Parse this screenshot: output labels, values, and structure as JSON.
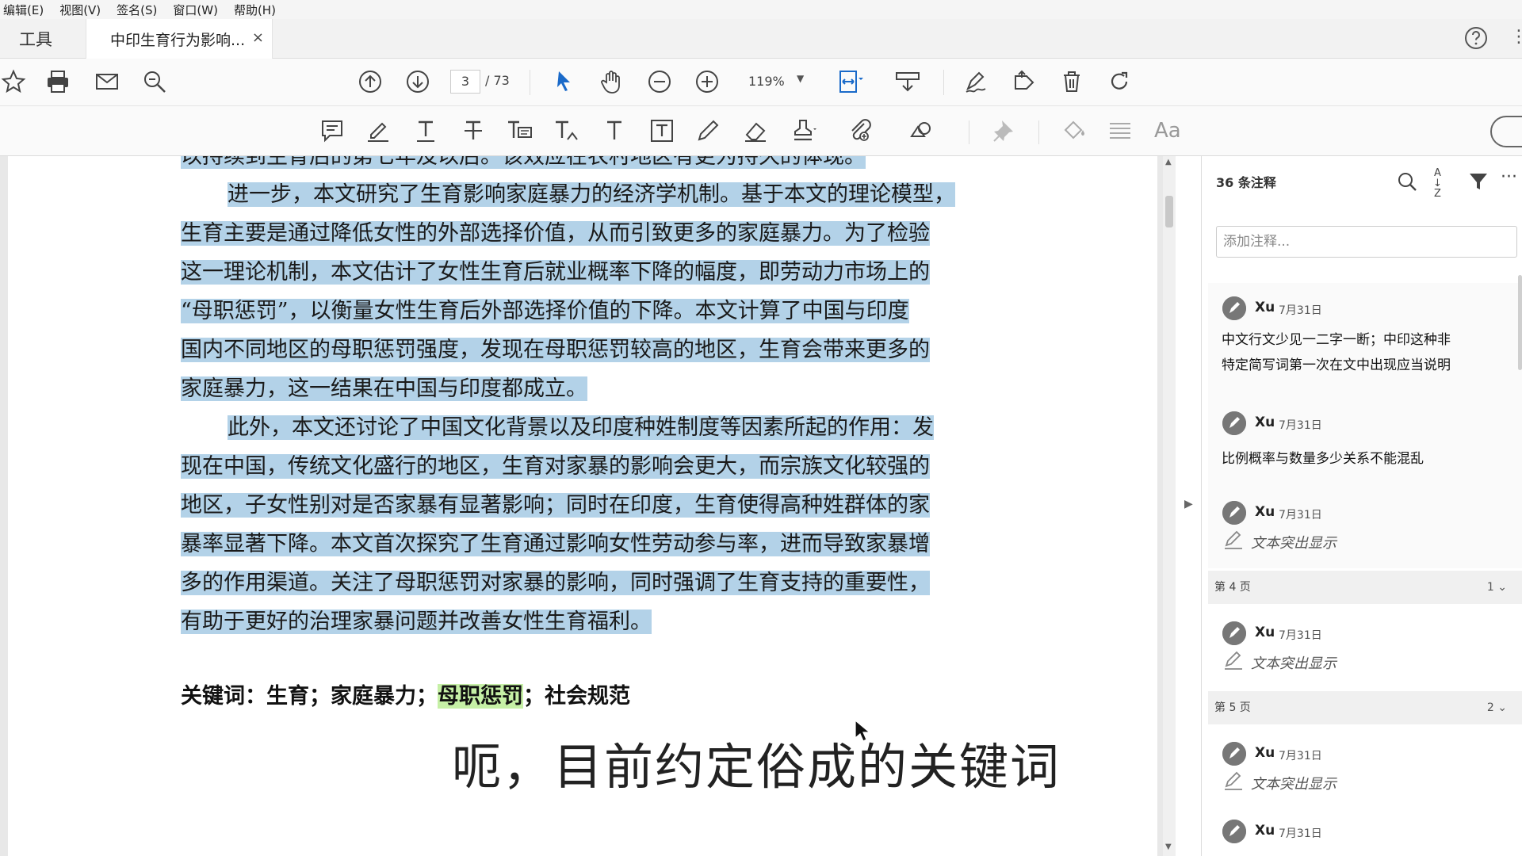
{
  "menu": {
    "items": [
      "编辑(E)",
      "视图(V)",
      "签名(S)",
      "窗口(W)",
      "帮助(H)"
    ]
  },
  "tabs": {
    "tools": "工具",
    "document": "中印生育行为影响...",
    "close": "×"
  },
  "toolbar": {
    "page_current": "3",
    "page_total": "/ 73",
    "zoom": "119%"
  },
  "document": {
    "lines": [
      {
        "text": "以持续到生育后的第七年及以后。该效应在农村地区有更为持久的体现。",
        "indent": false,
        "partial_top": true
      },
      {
        "text": "进一步，本文研究了生育影响家庭暴力的经济学机制。基于本文的理论模型，",
        "indent": true
      },
      {
        "text": "生育主要是通过降低女性的外部选择价值，从而引致更多的家庭暴力。为了检验",
        "indent": false
      },
      {
        "text": "这一理论机制，本文估计了女性生育后就业概率下降的幅度，即劳动力市场上的",
        "indent": false
      },
      {
        "text": "“母职惩罚”，以衡量女性生育后外部选择价值的下降。本文计算了中国与印度",
        "indent": false
      },
      {
        "text": "国内不同地区的母职惩罚强度，发现在母职惩罚较高的地区，生育会带来更多的",
        "indent": false
      },
      {
        "text": "家庭暴力，这一结果在中国与印度都成立。",
        "indent": false
      },
      {
        "text": "此外，本文还讨论了中国文化背景以及印度种姓制度等因素所起的作用：发",
        "indent": true
      },
      {
        "text": "现在中国，传统文化盛行的地区，生育对家暴的影响会更大，而宗族文化较强的",
        "indent": false
      },
      {
        "text": "地区，子女性别对是否家暴有显著影响；同时在印度，生育使得高种姓群体的家",
        "indent": false
      },
      {
        "text": "暴率显著下降。本文首次探究了生育通过影响女性劳动参与率，进而导致家暴增",
        "indent": false
      },
      {
        "text": "多的作用渠道。关注了母职惩罚对家暴的影响，同时强调了生育支持的重要性，",
        "indent": false
      },
      {
        "text": "有助于更好的治理家暴问题并改善女性生育福利。",
        "indent": false
      }
    ],
    "keywords_label": "关键词：生育；家庭暴力；",
    "keywords_highlight": "母职惩罚",
    "keywords_rest": "；社会规范"
  },
  "subtitle": "呃，目前约定俗成的关键词",
  "comments_panel": {
    "count": "36 条注释",
    "input_placeholder": "添加注释...",
    "items": [
      {
        "author": "Xu",
        "date": "7月31日",
        "text_lines": [
          "中文行文少见一二字一断；中印这种非",
          "特定简写词第一次在文中出现应当说明"
        ]
      },
      {
        "author": "Xu",
        "date": "7月31日",
        "text_lines": [
          "比例概率与数量多少关系不能混乱"
        ]
      },
      {
        "author": "Xu",
        "date": "7月31日",
        "highlight": "文本突出显示"
      }
    ],
    "page_groups": [
      {
        "label": "第 4 页",
        "count": "1",
        "items": [
          {
            "author": "Xu",
            "date": "7月31日",
            "highlight": "文本突出显示"
          }
        ]
      },
      {
        "label": "第 5 页",
        "count": "2",
        "items": [
          {
            "author": "Xu",
            "date": "7月31日",
            "highlight": "文本突出显示"
          },
          {
            "author": "Xu",
            "date": "7月31日"
          }
        ]
      }
    ]
  },
  "colors": {
    "selection": "#b3d2e8",
    "keyword_highlight": "#c6f0a6",
    "accent": "#1a6ac9"
  }
}
